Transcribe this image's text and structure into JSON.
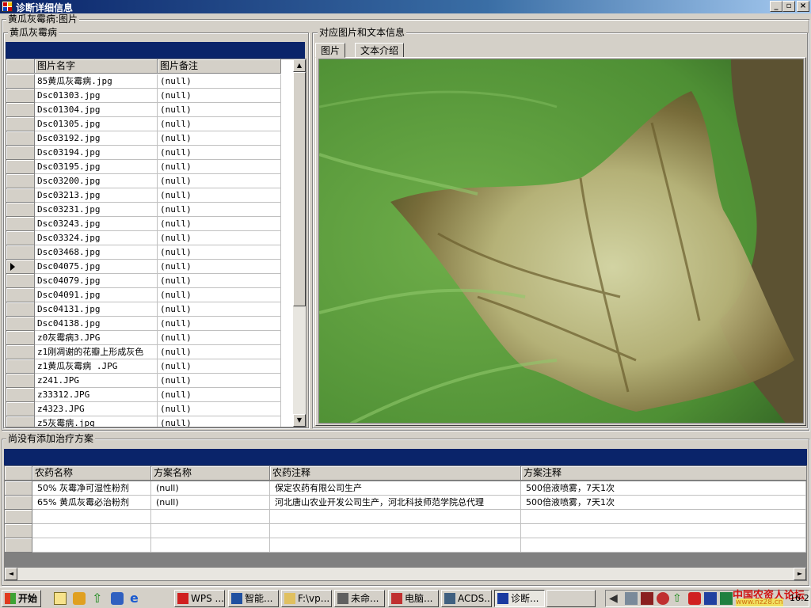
{
  "window": {
    "title": "诊断详细信息"
  },
  "disease_group": {
    "label": "黄瓜灰霉病:图片"
  },
  "left_panel": {
    "label": "黄瓜灰霉病",
    "columns": [
      "图片名字",
      "图片备注"
    ],
    "rows": [
      {
        "name": "85黄瓜灰霉病.jpg",
        "note": "(null)"
      },
      {
        "name": "Dsc01303.jpg",
        "note": "(null)"
      },
      {
        "name": "Dsc01304.jpg",
        "note": "(null)"
      },
      {
        "name": "Dsc01305.jpg",
        "note": "(null)"
      },
      {
        "name": "Dsc03192.jpg",
        "note": "(null)"
      },
      {
        "name": "Dsc03194.jpg",
        "note": "(null)"
      },
      {
        "name": "Dsc03195.jpg",
        "note": "(null)"
      },
      {
        "name": "Dsc03200.jpg",
        "note": "(null)"
      },
      {
        "name": "Dsc03213.jpg",
        "note": "(null)"
      },
      {
        "name": "Dsc03231.jpg",
        "note": "(null)"
      },
      {
        "name": "Dsc03243.jpg",
        "note": "(null)"
      },
      {
        "name": "Dsc03324.jpg",
        "note": "(null)"
      },
      {
        "name": "Dsc03468.jpg",
        "note": "(null)"
      },
      {
        "name": "Dsc04075.jpg",
        "note": "(null)"
      },
      {
        "name": "Dsc04079.jpg",
        "note": "(null)"
      },
      {
        "name": "Dsc04091.jpg",
        "note": "(null)"
      },
      {
        "name": "Dsc04131.jpg",
        "note": "(null)"
      },
      {
        "name": "Dsc04138.jpg",
        "note": "(null)"
      },
      {
        "name": "z0灰霉病3.JPG",
        "note": "(null)"
      },
      {
        "name": "z1刚凋谢的花瓣上形成灰色",
        "note": "(null)"
      },
      {
        "name": "z1黄瓜灰霉病 .JPG",
        "note": "(null)"
      },
      {
        "name": "z241.JPG",
        "note": "(null)"
      },
      {
        "name": "z33312.JPG",
        "note": "(null)"
      },
      {
        "name": "z4323.JPG",
        "note": "(null)"
      },
      {
        "name": "z5灰霉病.jpg",
        "note": "(null)"
      }
    ],
    "current_row": 13
  },
  "right_panel": {
    "label": "对应图片和文本信息",
    "tabs": [
      "图片",
      "文本介绍"
    ]
  },
  "bottom_panel": {
    "label": "尚没有添加治疗方案",
    "columns": [
      "农药名称",
      "方案名称",
      "农药注释",
      "方案注释"
    ],
    "rows": [
      {
        "pesticide": "50% 灰霉净可湿性粉剂",
        "plan": "(null)",
        "pesticide_note": "保定农药有限公司生产",
        "plan_note": "500倍液喷雾，7天1次"
      },
      {
        "pesticide": "65% 黄瓜灰霉必治粉剂",
        "plan": "(null)",
        "pesticide_note": "河北唐山农业开发公司生产，河北科技师范学院总代理",
        "plan_note": "500倍液喷雾，7天1次"
      }
    ]
  },
  "taskbar": {
    "start": "开始",
    "items": [
      "WPS ...",
      "智能...",
      "F:\\vp...",
      "未命...",
      "电脑...",
      "ACDS...",
      "诊断..."
    ],
    "active_index": 6,
    "watermark": "中国农资人论坛",
    "watermark_url": "www.nz28.cn",
    "clock": "16:2"
  },
  "colors": {
    "accent": "#0a246a",
    "face": "#d4d0c8",
    "leaf": "#5a9a3c"
  }
}
